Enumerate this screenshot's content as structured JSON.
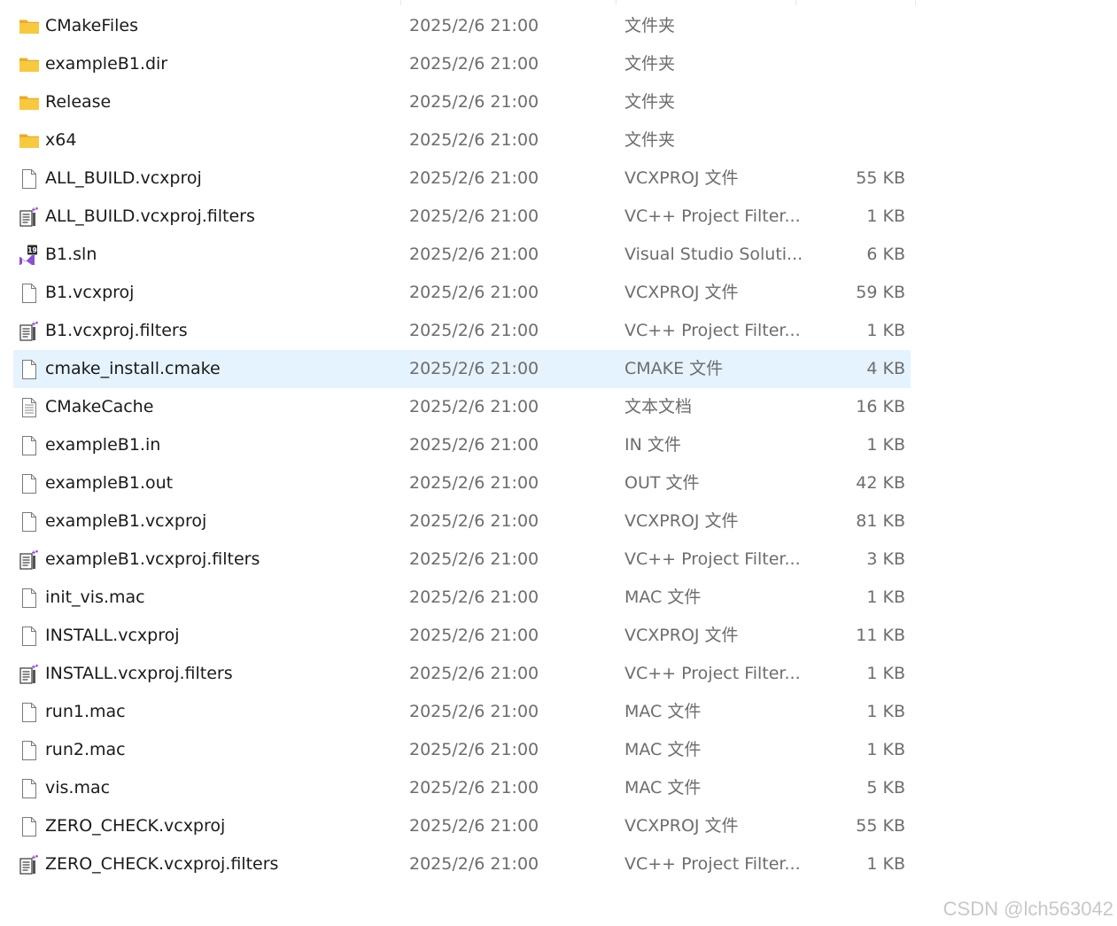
{
  "files": [
    {
      "name": "CMakeFiles",
      "date": "2025/2/6 21:00",
      "type": "文件夹",
      "size": "",
      "icon": "folder-icon"
    },
    {
      "name": "exampleB1.dir",
      "date": "2025/2/6 21:00",
      "type": "文件夹",
      "size": "",
      "icon": "folder-icon"
    },
    {
      "name": "Release",
      "date": "2025/2/6 21:00",
      "type": "文件夹",
      "size": "",
      "icon": "folder-icon"
    },
    {
      "name": "x64",
      "date": "2025/2/6 21:00",
      "type": "文件夹",
      "size": "",
      "icon": "folder-icon"
    },
    {
      "name": "ALL_BUILD.vcxproj",
      "date": "2025/2/6 21:00",
      "type": "VCXPROJ 文件",
      "size": "55 KB",
      "icon": "blank-file-icon"
    },
    {
      "name": "ALL_BUILD.vcxproj.filters",
      "date": "2025/2/6 21:00",
      "type": "VC++ Project Filter...",
      "size": "1 KB",
      "icon": "filters-file-icon"
    },
    {
      "name": "B1.sln",
      "date": "2025/2/6 21:00",
      "type": "Visual Studio Soluti...",
      "size": "6 KB",
      "icon": "visual-studio-solution-icon"
    },
    {
      "name": "B1.vcxproj",
      "date": "2025/2/6 21:00",
      "type": "VCXPROJ 文件",
      "size": "59 KB",
      "icon": "blank-file-icon"
    },
    {
      "name": "B1.vcxproj.filters",
      "date": "2025/2/6 21:00",
      "type": "VC++ Project Filter...",
      "size": "1 KB",
      "icon": "filters-file-icon"
    },
    {
      "name": "cmake_install.cmake",
      "date": "2025/2/6 21:00",
      "type": "CMAKE 文件",
      "size": "4 KB",
      "icon": "blank-file-icon",
      "selected": true
    },
    {
      "name": "CMakeCache",
      "date": "2025/2/6 21:00",
      "type": "文本文档",
      "size": "16 KB",
      "icon": "text-document-icon"
    },
    {
      "name": "exampleB1.in",
      "date": "2025/2/6 21:00",
      "type": "IN 文件",
      "size": "1 KB",
      "icon": "blank-file-icon"
    },
    {
      "name": "exampleB1.out",
      "date": "2025/2/6 21:00",
      "type": "OUT 文件",
      "size": "42 KB",
      "icon": "blank-file-icon"
    },
    {
      "name": "exampleB1.vcxproj",
      "date": "2025/2/6 21:00",
      "type": "VCXPROJ 文件",
      "size": "81 KB",
      "icon": "blank-file-icon"
    },
    {
      "name": "exampleB1.vcxproj.filters",
      "date": "2025/2/6 21:00",
      "type": "VC++ Project Filter...",
      "size": "3 KB",
      "icon": "filters-file-icon"
    },
    {
      "name": "init_vis.mac",
      "date": "2025/2/6 21:00",
      "type": "MAC 文件",
      "size": "1 KB",
      "icon": "blank-file-icon"
    },
    {
      "name": "INSTALL.vcxproj",
      "date": "2025/2/6 21:00",
      "type": "VCXPROJ 文件",
      "size": "11 KB",
      "icon": "blank-file-icon"
    },
    {
      "name": "INSTALL.vcxproj.filters",
      "date": "2025/2/6 21:00",
      "type": "VC++ Project Filter...",
      "size": "1 KB",
      "icon": "filters-file-icon"
    },
    {
      "name": "run1.mac",
      "date": "2025/2/6 21:00",
      "type": "MAC 文件",
      "size": "1 KB",
      "icon": "blank-file-icon"
    },
    {
      "name": "run2.mac",
      "date": "2025/2/6 21:00",
      "type": "MAC 文件",
      "size": "1 KB",
      "icon": "blank-file-icon"
    },
    {
      "name": "vis.mac",
      "date": "2025/2/6 21:00",
      "type": "MAC 文件",
      "size": "5 KB",
      "icon": "blank-file-icon"
    },
    {
      "name": "ZERO_CHECK.vcxproj",
      "date": "2025/2/6 21:00",
      "type": "VCXPROJ 文件",
      "size": "55 KB",
      "icon": "blank-file-icon"
    },
    {
      "name": "ZERO_CHECK.vcxproj.filters",
      "date": "2025/2/6 21:00",
      "type": "VC++ Project Filter...",
      "size": "1 KB",
      "icon": "filters-file-icon"
    }
  ],
  "watermark": "CSDN @lch563042",
  "colors": {
    "selected_row": "#e5f3ff",
    "folder": "#f8c93e",
    "visual_studio": "#8a4fd6",
    "secondary_text": "#6d6d6d"
  }
}
